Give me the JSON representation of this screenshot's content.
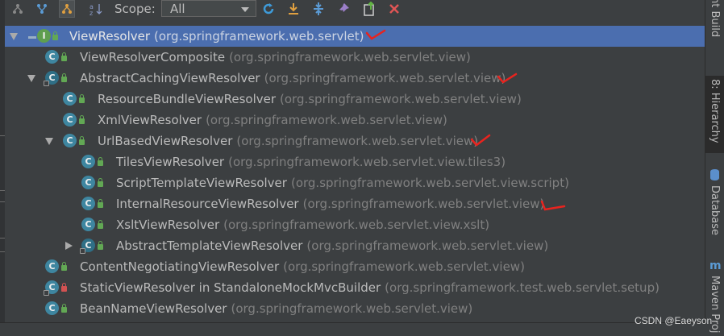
{
  "toolbar": {
    "scope_label": "Scope:",
    "scope_value": "All",
    "icons": [
      "supertypes-hierarchy-icon",
      "class-hierarchy-icon",
      "subtypes-hierarchy-icon",
      "sort-alphabetically-icon",
      "refresh-icon",
      "export-icon",
      "expand-all-icon",
      "pin-icon",
      "open-in-new-tab-icon",
      "close-icon"
    ]
  },
  "tree": {
    "rows": [
      {
        "name": "ViewResolver",
        "pkg": "(org.springframework.web.servlet)",
        "kind": "interface",
        "expanded": true,
        "selected": true,
        "marked": true
      },
      {
        "name": "ViewResolverComposite",
        "pkg": "(org.springframework.web.servlet.view)",
        "kind": "class"
      },
      {
        "name": "AbstractCachingViewResolver",
        "pkg": "(org.springframework.web.servlet.view)",
        "kind": "abstract",
        "expanded": true,
        "marked": true
      },
      {
        "name": "ResourceBundleViewResolver",
        "pkg": "(org.springframework.web.servlet.view)",
        "kind": "class"
      },
      {
        "name": "XmlViewResolver",
        "pkg": "(org.springframework.web.servlet.view)",
        "kind": "class"
      },
      {
        "name": "UrlBasedViewResolver",
        "pkg": "(org.springframework.web.servlet.view)",
        "kind": "class",
        "expanded": true,
        "marked": true
      },
      {
        "name": "TilesViewResolver",
        "pkg": "(org.springframework.web.servlet.view.tiles3)",
        "kind": "class"
      },
      {
        "name": "ScriptTemplateViewResolver",
        "pkg": "(org.springframework.web.servlet.view.script)",
        "kind": "class"
      },
      {
        "name": "InternalResourceViewResolver",
        "pkg": "(org.springframework.web.servlet.view)",
        "kind": "class",
        "marked": true
      },
      {
        "name": "XsltViewResolver",
        "pkg": "(org.springframework.web.servlet.view.xslt)",
        "kind": "class"
      },
      {
        "name": "AbstractTemplateViewResolver",
        "pkg": "(org.springframework.web.servlet.view)",
        "kind": "abstract",
        "collapsed": true
      },
      {
        "name": "ContentNegotiatingViewResolver",
        "pkg": "(org.springframework.web.servlet.view)",
        "kind": "class"
      },
      {
        "name": "StaticViewResolver in StandaloneMockMvcBuilder",
        "pkg": "(org.springframework.test.web.servlet.setup)",
        "kind": "static-class",
        "private": true
      },
      {
        "name": "BeanNameViewResolver",
        "pkg": "(org.springframework.web.servlet.view)",
        "kind": "class"
      }
    ]
  },
  "right_tool_windows": [
    {
      "label": "nt Build"
    },
    {
      "label": "8: Hierarchy",
      "active": true
    },
    {
      "label": "Database"
    },
    {
      "label": "Maven Proj"
    }
  ],
  "watermark": "CSDN @Eaeyson",
  "colors": {
    "selection": "#4b6eaf",
    "background": "#3c3f41",
    "annotation": "#e8231e"
  }
}
